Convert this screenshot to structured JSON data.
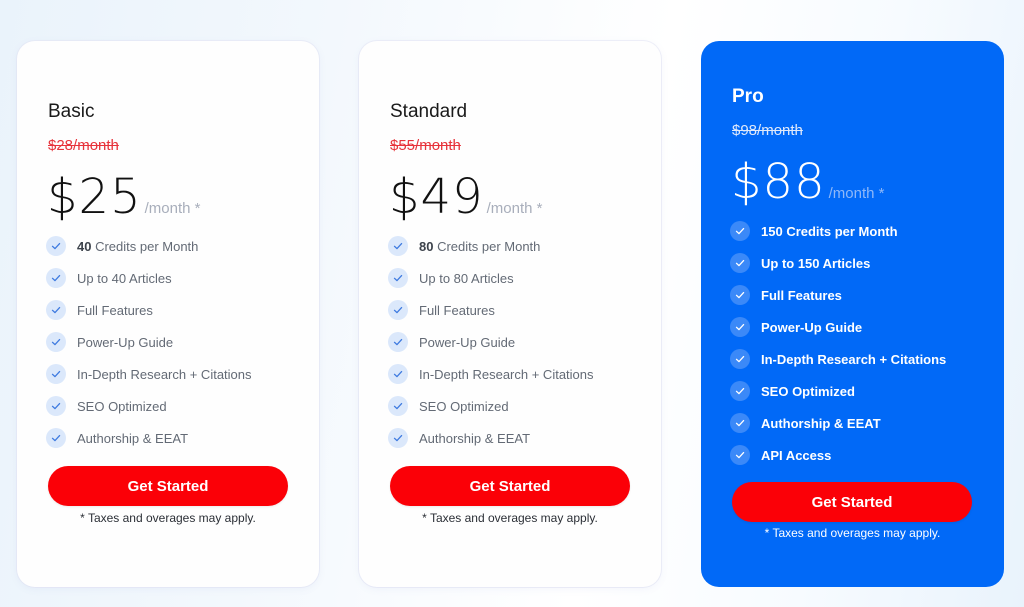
{
  "plans": [
    {
      "name": "Basic",
      "old_price": "$28/month",
      "price": "$25",
      "per": "/month *",
      "features": [
        {
          "bold": "40",
          "text": " Credits per Month"
        },
        {
          "bold": "",
          "text": "Up to 40 Articles"
        },
        {
          "bold": "",
          "text": "Full Features"
        },
        {
          "bold": "",
          "text": "Power-Up Guide"
        },
        {
          "bold": "",
          "text": "In-Depth Research + Citations"
        },
        {
          "bold": "",
          "text": "SEO Optimized"
        },
        {
          "bold": "",
          "text": "Authorship & EEAT"
        }
      ],
      "cta": "Get Started",
      "note": "* Taxes and overages may apply."
    },
    {
      "name": "Standard",
      "old_price": "$55/month",
      "price": "$49",
      "per": "/month *",
      "features": [
        {
          "bold": "80",
          "text": " Credits per Month"
        },
        {
          "bold": "",
          "text": "Up to 80 Articles"
        },
        {
          "bold": "",
          "text": "Full Features"
        },
        {
          "bold": "",
          "text": "Power-Up Guide"
        },
        {
          "bold": "",
          "text": "In-Depth Research + Citations"
        },
        {
          "bold": "",
          "text": "SEO Optimized"
        },
        {
          "bold": "",
          "text": "Authorship & EEAT"
        }
      ],
      "cta": "Get Started",
      "note": "* Taxes and overages may apply."
    },
    {
      "name": "Pro",
      "old_price": "$98/month",
      "price": "$88",
      "per": "/month *",
      "features": [
        {
          "bold": "150",
          "text": " Credits per Month"
        },
        {
          "bold": "",
          "text": "Up to 150 Articles"
        },
        {
          "bold": "",
          "text": "Full Features"
        },
        {
          "bold": "",
          "text": "Power-Up Guide"
        },
        {
          "bold": "",
          "text": "In-Depth Research + Citations"
        },
        {
          "bold": "",
          "text": "SEO Optimized"
        },
        {
          "bold": "",
          "text": "Authorship & EEAT"
        },
        {
          "bold": "",
          "text": "API Access"
        }
      ],
      "cta": "Get Started",
      "note": "* Taxes and overages may apply."
    }
  ],
  "icons": {
    "feature_check": "check-icon"
  },
  "colors": {
    "cta": "#fb0007",
    "pro_card": "#0169f7",
    "old_price": "#e7333b",
    "check_bg": "#dbe8fb"
  }
}
